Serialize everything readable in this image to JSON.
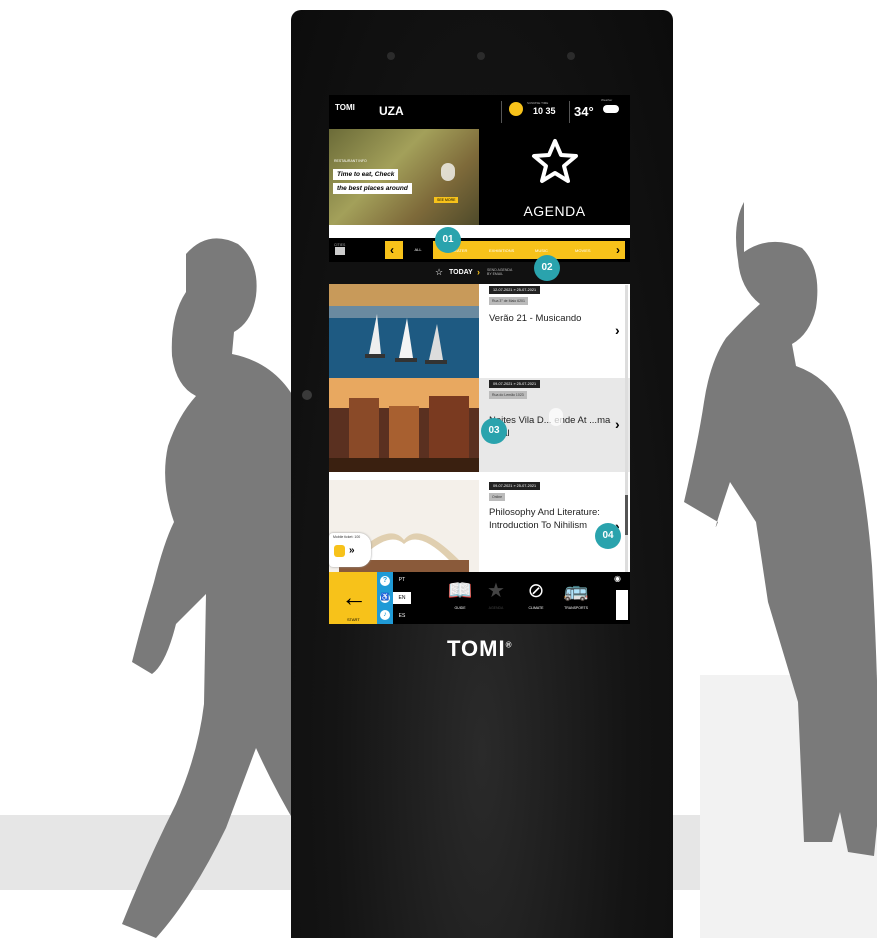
{
  "kiosk": {
    "brand": "TOMI"
  },
  "screen": {
    "header": {
      "logo": "TOMI",
      "town": "UZA",
      "sun_label": "SUNRISE TIME",
      "time": "10 35",
      "temperature": "34°",
      "weather_label": "Weather"
    },
    "promo": {
      "tag": "RESTAURANT INFO",
      "line1": "Time to eat, Check",
      "line2": "the best places around",
      "button": "SEE MORE"
    },
    "agenda": {
      "title": "AGENDA"
    },
    "city": {
      "label": "CITIES"
    },
    "categories": {
      "all": "ALL",
      "items": [
        "THEATER",
        "EXHIBITIONS",
        "MUSIC",
        "MOVIES"
      ]
    },
    "today": {
      "label": "TODAY",
      "send_label": "SEND AGENDA BY EMAIL"
    },
    "events": [
      {
        "date": "12-07-2021 » 25-07-2021",
        "location": "Rua 3° de Maio 6201",
        "title": "Verão 21 - Musicando"
      },
      {
        "date": "09-07-2021 » 25-07-2021",
        "location": "Rua do Lemão 1023",
        "location2": "1100-345 Lisboa",
        "title": "Noites Vila D... ende At ...ma Ideal"
      },
      {
        "date": "09-07-2021 » 25-07-2021",
        "location": "Online",
        "title": "Philosophy And Literature: Introduction To Nihilism"
      }
    ],
    "widget": {
      "label": "Mobile ticket: 100"
    },
    "bottom": {
      "start": "START",
      "languages": [
        "PT",
        "EN",
        "ES"
      ],
      "nav": [
        {
          "icon": "book-icon",
          "label": "GUIDE"
        },
        {
          "icon": "star-icon",
          "label": "AGENDA"
        },
        {
          "icon": "compass-icon",
          "label": "CLIMATE"
        },
        {
          "icon": "bus-icon",
          "label": "TRANSPORTS"
        }
      ]
    }
  },
  "callouts": [
    "01",
    "02",
    "03",
    "04"
  ]
}
